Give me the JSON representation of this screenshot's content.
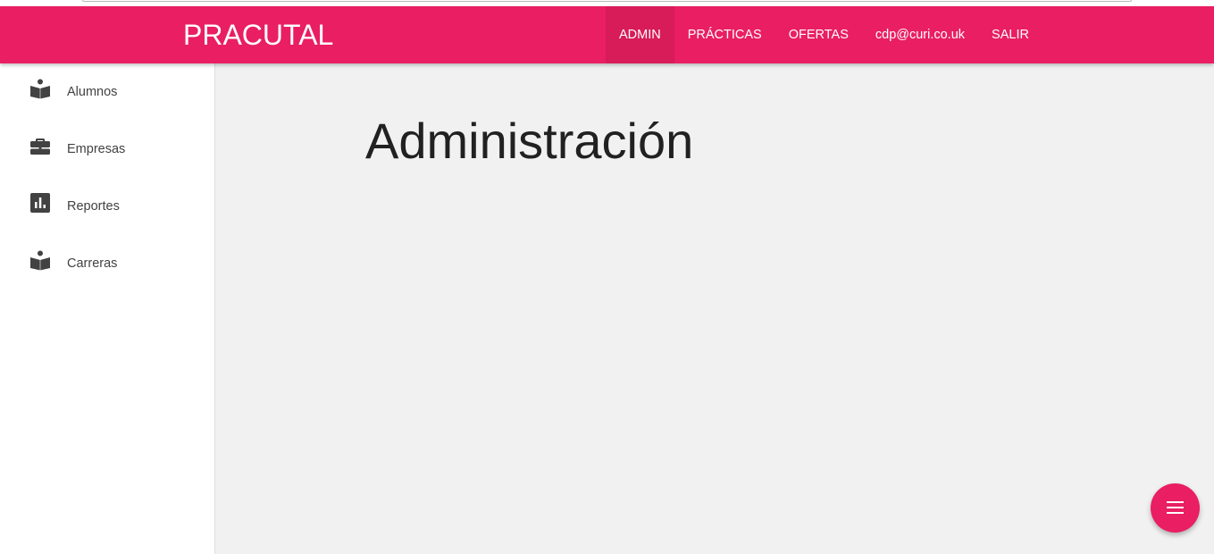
{
  "navbar": {
    "brand": "PRACUTAL",
    "links": [
      {
        "label": "ADMIN",
        "active": true
      },
      {
        "label": "PRÁCTICAS",
        "active": false
      },
      {
        "label": "OFERTAS",
        "active": false
      },
      {
        "label": "cdp@curi.co.uk",
        "active": false
      },
      {
        "label": "SALIR",
        "active": false
      }
    ]
  },
  "sidebar": {
    "items": [
      {
        "label": "Alumnos",
        "icon": "book-person-icon"
      },
      {
        "label": "Empresas",
        "icon": "briefcase-icon"
      },
      {
        "label": "Reportes",
        "icon": "bar-chart-icon"
      },
      {
        "label": "Carreras",
        "icon": "book-person-icon"
      }
    ]
  },
  "main": {
    "title": "Administración"
  },
  "fab": {
    "icon": "menu-icon"
  },
  "colors": {
    "primary": "#e91e63",
    "primary_dark": "#d81b59",
    "background": "#f1f1f1",
    "sidebar_bg": "#ffffff",
    "icon": "#424242"
  }
}
